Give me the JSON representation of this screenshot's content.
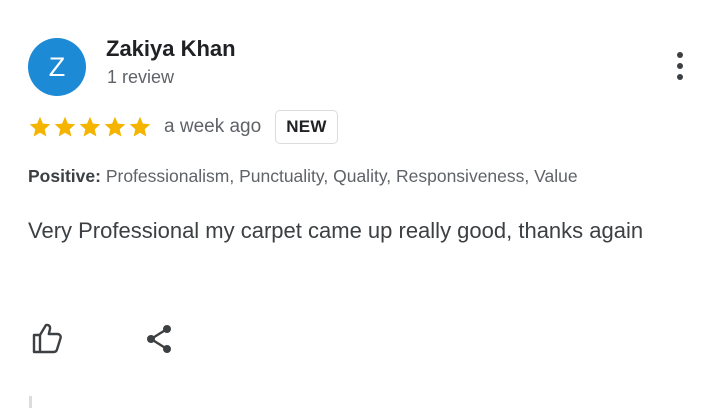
{
  "review": {
    "author": {
      "initial": "Z",
      "name": "Zakiya Khan",
      "review_count": "1 review",
      "avatar_color": "#1d8ad6"
    },
    "rating": 5,
    "rating_max": 5,
    "star_color": "#f4b400",
    "time_ago": "a week ago",
    "badge": "NEW",
    "attributes": {
      "label": "Positive:",
      "values": "Professionalism, Punctuality, Quality, Responsiveness, Value"
    },
    "text": "Very Professional my carpet came up really good, thanks again",
    "actions": {
      "like_icon": "thumbs-up-icon",
      "share_icon": "share-icon",
      "more_icon": "more-vert-icon"
    }
  }
}
